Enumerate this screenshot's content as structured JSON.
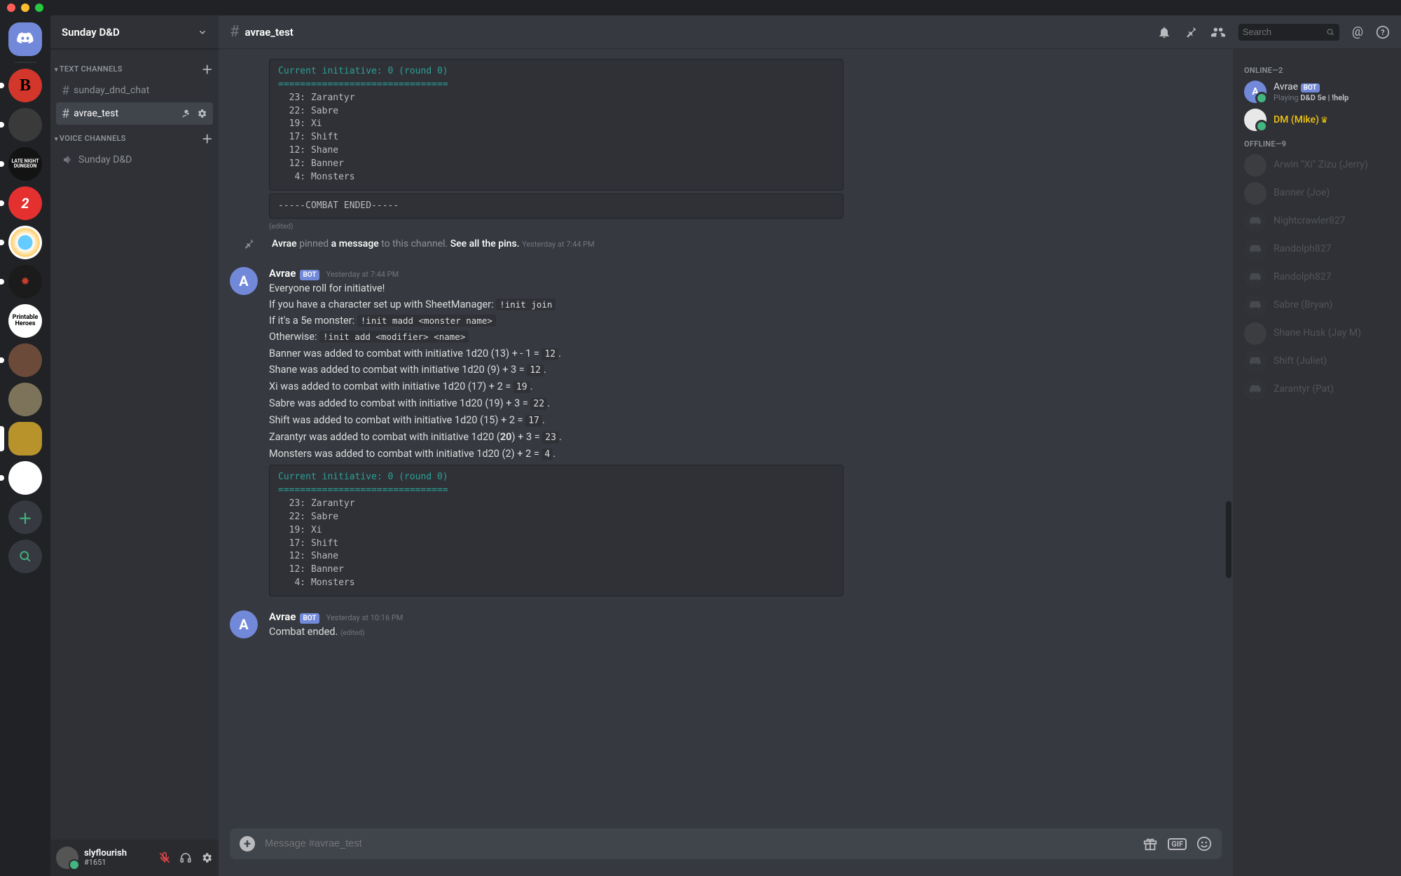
{
  "server": {
    "name": "Sunday D&D"
  },
  "categories": {
    "text": {
      "label": "TEXT CHANNELS"
    },
    "voice": {
      "label": "VOICE CHANNELS"
    }
  },
  "channels": {
    "text": [
      {
        "name": "sunday_dnd_chat"
      },
      {
        "name": "avrae_test"
      }
    ],
    "voice": [
      {
        "name": "Sunday D&D"
      }
    ]
  },
  "current_channel": "avrae_test",
  "user": {
    "name": "slyflourish",
    "discriminator": "#1651"
  },
  "search": {
    "placeholder": "Search"
  },
  "composer": {
    "placeholder": "Message #avrae_test"
  },
  "system_pin": {
    "author": "Avrae",
    "mid1": "pinned",
    "mid2": "a message",
    "mid3": "to this channel.",
    "link": "See all the pins.",
    "ts": "Yesterday at 7:44 PM"
  },
  "bot_tag": "BOT",
  "edited_label": "(edited)",
  "initiative_block": {
    "h1": "Current initiative: 0 (round 0)",
    "h2": "===============================",
    "rows": [
      "  23: Zarantyr",
      "  22: Sabre",
      "  19: Xi",
      "  17: Shift",
      "  12: Shane",
      "  12: Banner",
      "   4: Monsters"
    ]
  },
  "combat_ended_block": "-----COMBAT ENDED-----",
  "msg1": {
    "author": "Avrae",
    "ts": "Yesterday at 7:44 PM",
    "l1": "Everyone roll for initiative!",
    "l2a": "If you have a character set up with SheetManager:",
    "l2code": "!init join",
    "l3a": "If it's a 5e monster:",
    "l3code": "!init madd <monster name>",
    "l4a": "Otherwise:",
    "l4code": "!init add <modifier> <name>",
    "r1a": "Banner was added to combat with initiative 1d20 (13) + - 1 =",
    "r1b": "12",
    "r1c": ".",
    "r2a": "Shane was added to combat with initiative 1d20 (9) + 3 =",
    "r2b": "12",
    "r2c": ".",
    "r3a": "Xi was added to combat with initiative 1d20 (17) + 2 =",
    "r3b": "19",
    "r3c": ".",
    "r4a": "Sabre was added to combat with initiative 1d20 (19) + 3 =",
    "r4b": "22",
    "r4c": ".",
    "r5a": "Shift was added to combat with initiative 1d20 (15) + 2 =",
    "r5b": "17",
    "r5c": ".",
    "r6a": "Zarantyr was added to combat with initiative 1d20 (",
    "r6b": "20",
    "r6c": ") + 3 =",
    "r6d": "23",
    "r6e": ".",
    "r7a": "Monsters was added to combat with initiative 1d20 (2) + 2 =",
    "r7b": "4",
    "r7c": "."
  },
  "msg2": {
    "author": "Avrae",
    "ts": "Yesterday at 10:16 PM",
    "text": "Combat ended."
  },
  "members": {
    "online_label": "ONLINE—2",
    "offline_label": "OFFLINE—9",
    "online": [
      {
        "name": "Avrae",
        "status_prefix": "Playing ",
        "status_bold": "D&D 5e | !help",
        "bot": true
      },
      {
        "name": "DM (Mike)",
        "owner": true
      }
    ],
    "offline": [
      {
        "name": "Arwin \"Xi\" Zizu (Jerry)"
      },
      {
        "name": "Banner (Joe)"
      },
      {
        "name": "Nightcrawler827"
      },
      {
        "name": "Randolph827"
      },
      {
        "name": "Randolph827"
      },
      {
        "name": "Sabre (Bryan)"
      },
      {
        "name": "Shane Husk (Jay M)"
      },
      {
        "name": "Shift (Juliet)"
      },
      {
        "name": "Zarantyr (Pat)"
      }
    ]
  },
  "gif_label": "GIF"
}
